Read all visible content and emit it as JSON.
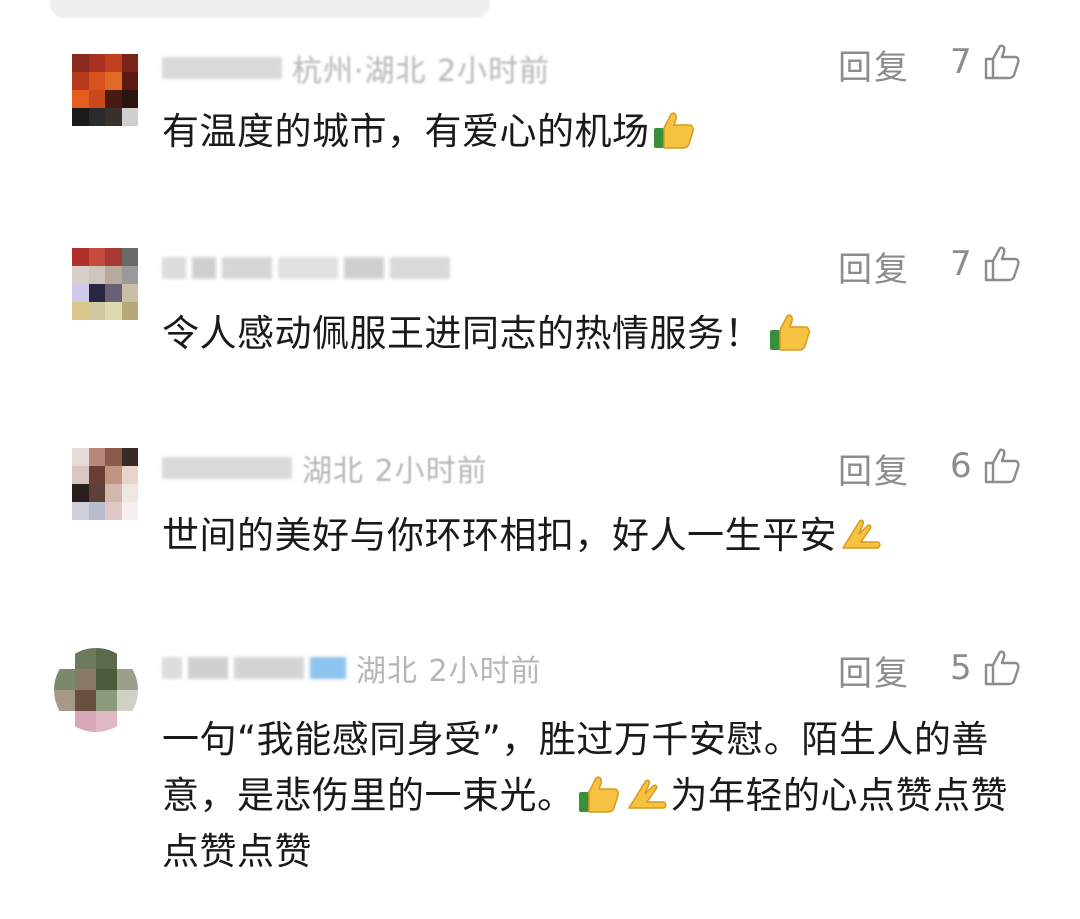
{
  "comments": [
    {
      "meta_text": "杭州·湖北 2小时前",
      "reply_label": "回复",
      "like_count": "7",
      "text": "有温度的城市，有爱心的机场",
      "emojis": [
        "thumbs-up"
      ]
    },
    {
      "meta_text": "",
      "reply_label": "回复",
      "like_count": "7",
      "text": "令人感动佩服王进同志的热情服务！",
      "emojis": [
        "thumbs-up"
      ]
    },
    {
      "meta_text": "湖北 2小时前",
      "reply_label": "回复",
      "like_count": "6",
      "text": "世间的美好与你环环相扣，好人一生平安",
      "emojis": [
        "folded-hands"
      ]
    },
    {
      "meta_text": "湖北 2小时前",
      "reply_label": "回复",
      "like_count": "5",
      "text_part1": "一句“我能感同身受”，胜过万千安慰。陌生人的善意，是悲伤里的一束光。",
      "text_part2": "为年轻的心点赞点赞点赞点赞",
      "emojis": [
        "thumbs-up",
        "folded-hands"
      ]
    }
  ],
  "colors": {
    "text": "#1a1a1a",
    "secondary": "#8c8c8c",
    "meta": "#b6b6b6"
  }
}
